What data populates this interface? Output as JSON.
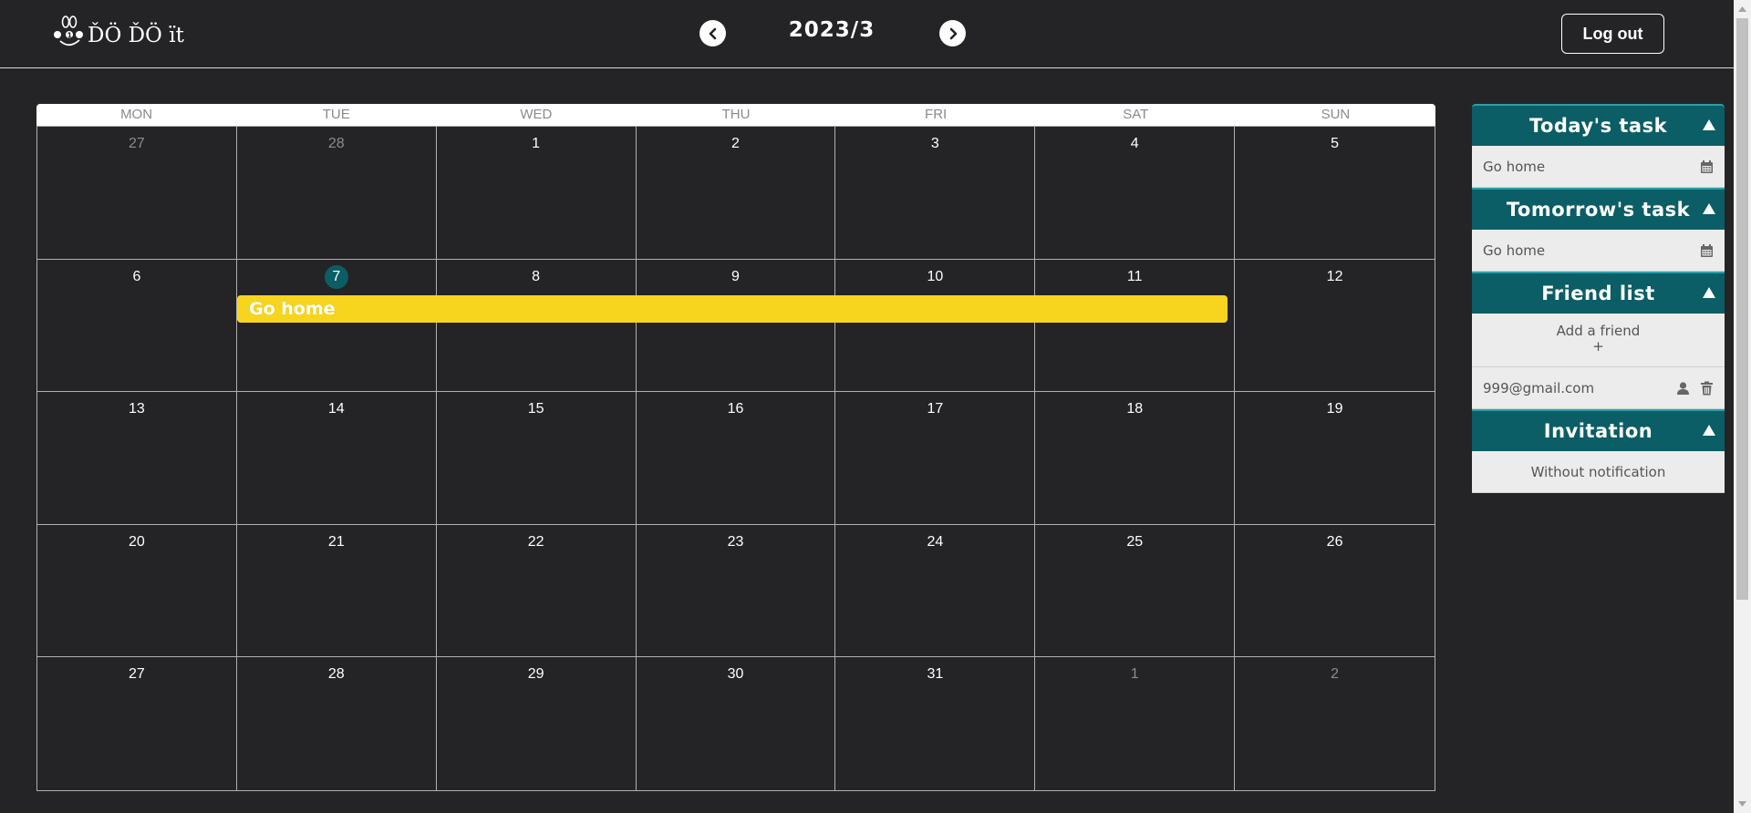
{
  "header": {
    "logo_text": "ĎÖ ĎÖ ït",
    "month_title": "2023/3",
    "prev_month_icon": "chevron-left-icon",
    "next_month_icon": "chevron-right-icon",
    "logout_label": "Log out"
  },
  "calendar": {
    "weekdays": [
      "MON",
      "TUE",
      "WED",
      "THU",
      "FRI",
      "SAT",
      "SUN"
    ],
    "today": "7",
    "days": [
      {
        "label": "27",
        "in_month": false
      },
      {
        "label": "28",
        "in_month": false
      },
      {
        "label": "1",
        "in_month": true
      },
      {
        "label": "2",
        "in_month": true
      },
      {
        "label": "3",
        "in_month": true
      },
      {
        "label": "4",
        "in_month": true
      },
      {
        "label": "5",
        "in_month": true
      },
      {
        "label": "6",
        "in_month": true
      },
      {
        "label": "7",
        "in_month": true
      },
      {
        "label": "8",
        "in_month": true
      },
      {
        "label": "9",
        "in_month": true
      },
      {
        "label": "10",
        "in_month": true
      },
      {
        "label": "11",
        "in_month": true
      },
      {
        "label": "12",
        "in_month": true
      },
      {
        "label": "13",
        "in_month": true
      },
      {
        "label": "14",
        "in_month": true
      },
      {
        "label": "15",
        "in_month": true
      },
      {
        "label": "16",
        "in_month": true
      },
      {
        "label": "17",
        "in_month": true
      },
      {
        "label": "18",
        "in_month": true
      },
      {
        "label": "19",
        "in_month": true
      },
      {
        "label": "20",
        "in_month": true
      },
      {
        "label": "21",
        "in_month": true
      },
      {
        "label": "22",
        "in_month": true
      },
      {
        "label": "23",
        "in_month": true
      },
      {
        "label": "24",
        "in_month": true
      },
      {
        "label": "25",
        "in_month": true
      },
      {
        "label": "26",
        "in_month": true
      },
      {
        "label": "27",
        "in_month": true
      },
      {
        "label": "28",
        "in_month": true
      },
      {
        "label": "29",
        "in_month": true
      },
      {
        "label": "30",
        "in_month": true
      },
      {
        "label": "31",
        "in_month": true
      },
      {
        "label": "1",
        "in_month": false
      },
      {
        "label": "2",
        "in_month": false
      }
    ],
    "event": {
      "title": "Go home",
      "start": "7",
      "end": "11",
      "color": "#f7d51f"
    }
  },
  "side": {
    "today_task": {
      "title": "Today's task",
      "items": [
        "Go home"
      ]
    },
    "tomorrow_task": {
      "title": "Tomorrow's task",
      "items": [
        "Go home"
      ]
    },
    "friend_list": {
      "title": "Friend list",
      "add_label": "Add a friend",
      "add_symbol": "+",
      "friends": [
        "999@gmail.com"
      ]
    },
    "invitation": {
      "title": "Invitation",
      "empty_text": "Without notification"
    }
  },
  "colors": {
    "background": "#242426",
    "accent": "#0b5d66",
    "event": "#f7d51f",
    "panel_row": "#ececec"
  }
}
